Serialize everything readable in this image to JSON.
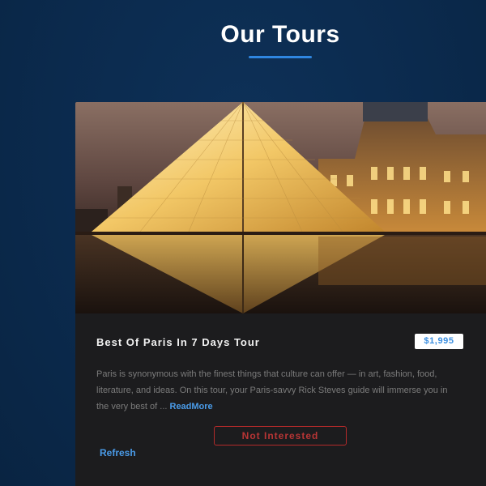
{
  "page": {
    "title": "Our Tours",
    "accent_color": "#2f86e0",
    "background_color": "#0b2a4d"
  },
  "tour": {
    "image_subject": "Louvre pyramid at night",
    "name": "Best Of Paris In 7 Days Tour",
    "price": "$1,995",
    "description": "Paris is synonymous with the finest things that culture can offer — in art, fashion, food, literature, and ideas. On this tour, your Paris-savvy Rick Steves guide will immerse you in the very best of ...",
    "read_more_label": "ReadMore",
    "not_interested_label": "Not Interested"
  },
  "refresh_label": "Refresh",
  "colors": {
    "card": "#1c1c1e",
    "price_text": "#3a8ee0",
    "link": "#4a9be8",
    "danger": "#b83535"
  }
}
